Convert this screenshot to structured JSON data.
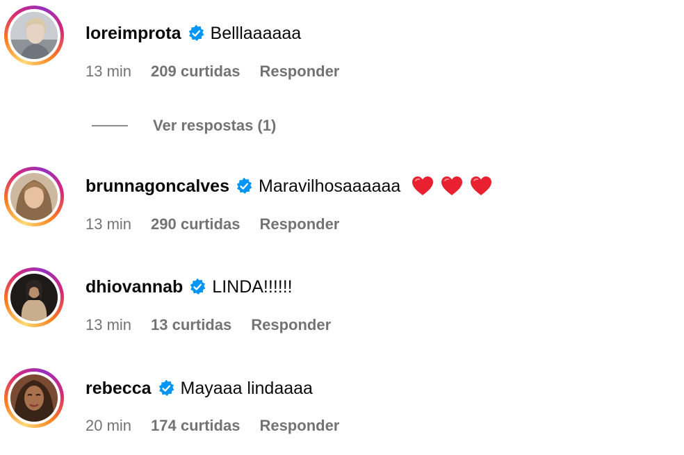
{
  "colors": {
    "verified": "#0095f6",
    "meta_text": "#737373",
    "heart": "#e8202f"
  },
  "comments": [
    {
      "username": "loreimprota",
      "verified": true,
      "text": "Belllaaaaaa",
      "time": "13 min",
      "likes": "209 curtidas",
      "reply_label": "Responder",
      "avatar_icon": "avatar-loreimprota"
    },
    {
      "username": "brunnagoncalves",
      "verified": true,
      "text": "Maravilhosaaaaaa",
      "emoji": [
        "red-heart",
        "red-heart",
        "red-heart"
      ],
      "time": "13 min",
      "likes": "290 curtidas",
      "reply_label": "Responder",
      "avatar_icon": "avatar-brunnagoncalves"
    },
    {
      "username": "dhiovannab",
      "verified": true,
      "text": "LINDA!!!!!!",
      "time": "13 min",
      "likes": "13 curtidas",
      "reply_label": "Responder",
      "avatar_icon": "avatar-dhiovannab"
    },
    {
      "username": "rebecca",
      "verified": true,
      "text": "Mayaaa lindaaaa",
      "time": "20 min",
      "likes": "174 curtidas",
      "reply_label": "Responder",
      "avatar_icon": "avatar-rebecca"
    }
  ],
  "view_replies": {
    "label": "Ver respostas (1)"
  }
}
